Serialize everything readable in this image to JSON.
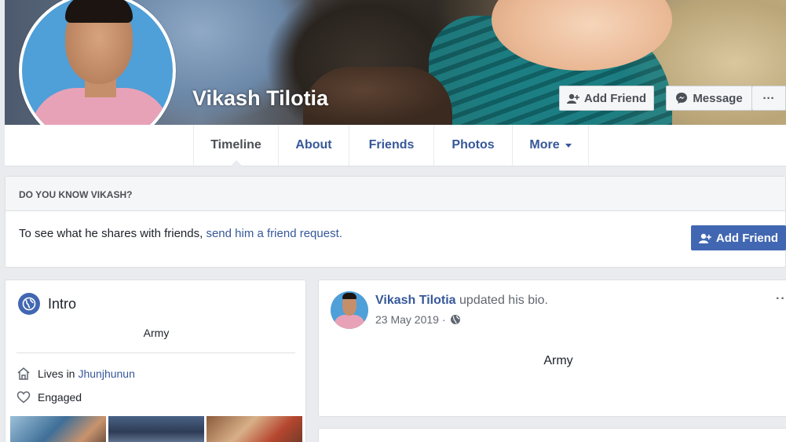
{
  "profile": {
    "name": "Vikash Tilotia"
  },
  "actions": {
    "add_friend_label": "Add Friend",
    "message_label": "Message",
    "more_label": "···"
  },
  "tabs": [
    {
      "label": "Timeline"
    },
    {
      "label": "About"
    },
    {
      "label": "Friends"
    },
    {
      "label": "Photos"
    },
    {
      "label": "More"
    }
  ],
  "know_box": {
    "heading": "DO YOU KNOW VIKASH?",
    "text": "To see what he shares with friends,",
    "link": "send him a friend request.",
    "button_label": "Add Friend"
  },
  "intro": {
    "title": "Intro",
    "bio": "Army",
    "lives_prefix": "Lives in",
    "lives_place": "Jhunjhunun",
    "relationship": "Engaged"
  },
  "post": {
    "author": "Vikash Tilotia",
    "action": "updated his bio.",
    "date": "23 May 2019 ·",
    "body": "Army",
    "menu": "··"
  },
  "colors": {
    "link": "#365899",
    "primary_button": "#4267b2",
    "background": "#e9ebee"
  }
}
